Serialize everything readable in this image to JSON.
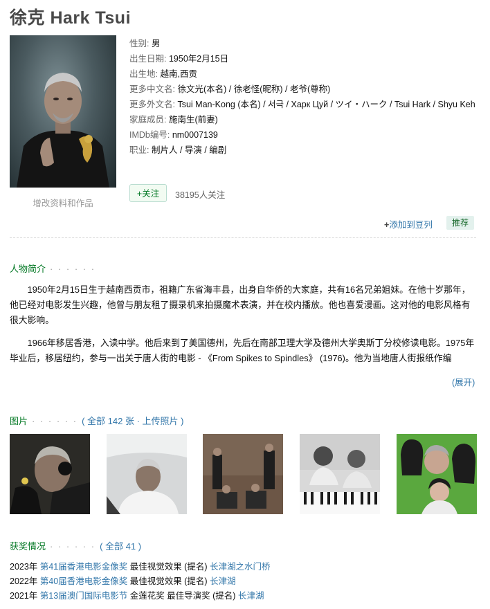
{
  "person": {
    "name": "徐克 Hark Tsui",
    "edit_link": "增改资料和作品"
  },
  "info": [
    {
      "label": "性别:",
      "value": "男"
    },
    {
      "label": "出生日期:",
      "value": "1950年2月15日"
    },
    {
      "label": "出生地:",
      "value": "越南,西贡"
    },
    {
      "label": "更多中文名:",
      "value": "徐文光(本名) / 徐老怪(昵称) / 老爷(尊称)"
    },
    {
      "label": "更多外文名:",
      "value": "Tsui Man-Kong (本名) / 서극 / Харк Цуй / ツイ・ハーク / Tsui Hark / Shyu Keh"
    },
    {
      "label": "家庭成员:",
      "value": "施南生(前妻)"
    },
    {
      "label": "IMDb编号:",
      "value": "nm0007139"
    },
    {
      "label": "职业:",
      "value": "制片人 / 导演 / 编剧"
    }
  ],
  "follow": {
    "button": "+关注",
    "count": "38195人关注"
  },
  "actions": {
    "add_doulist": "添加到豆列",
    "add_plus": "+",
    "recommend": "推荐"
  },
  "bio": {
    "title": "人物简介",
    "dots": "· · · · · ·",
    "paragraphs": [
      "1950年2月15日生于越南西贡市，祖籍广东省海丰县，出身自华侨的大家庭，共有16名兄弟姐妹。在他十岁那年，他已经对电影发生兴趣，他曾与朋友租了摄录机来拍摄魔术表演，并在校内播放。他也喜爱漫画。这对他的电影风格有很大影响。",
      "1966年移居香港，入读中学。他后来到了美国德州，先后在南部卫理大学及德州大学奥斯丁分校修读电影。1975年毕业后，移居纽约，参与一出关于唐人街的电影 - 《From Spikes to Spindles》 (1976)。他为当地唐人街报纸作编"
    ],
    "expand": "(展开)"
  },
  "photos": {
    "title": "图片",
    "dots": "· · · · · ·",
    "paren_open": "(",
    "all_link": "全部 142 张",
    "sep": " · ",
    "upload_link": "上传照片",
    "paren_close": ")"
  },
  "awards": {
    "title": "获奖情况",
    "dots": "· · · · · ·",
    "paren_open": "(",
    "all_link": "全部 41",
    "paren_close": ")",
    "items": [
      {
        "year": "2023年",
        "ceremony": "第41届香港电影金像奖",
        "category": "最佳视觉效果 (提名)",
        "film": "长津湖之水门桥"
      },
      {
        "year": "2022年",
        "ceremony": "第40届香港电影金像奖",
        "category": "最佳视觉效果 (提名)",
        "film": "长津湖"
      },
      {
        "year": "2021年",
        "ceremony": "第13届澳门国际电影节",
        "category": "金莲花奖 最佳导演奖 (提名)",
        "film": "长津湖"
      }
    ]
  }
}
